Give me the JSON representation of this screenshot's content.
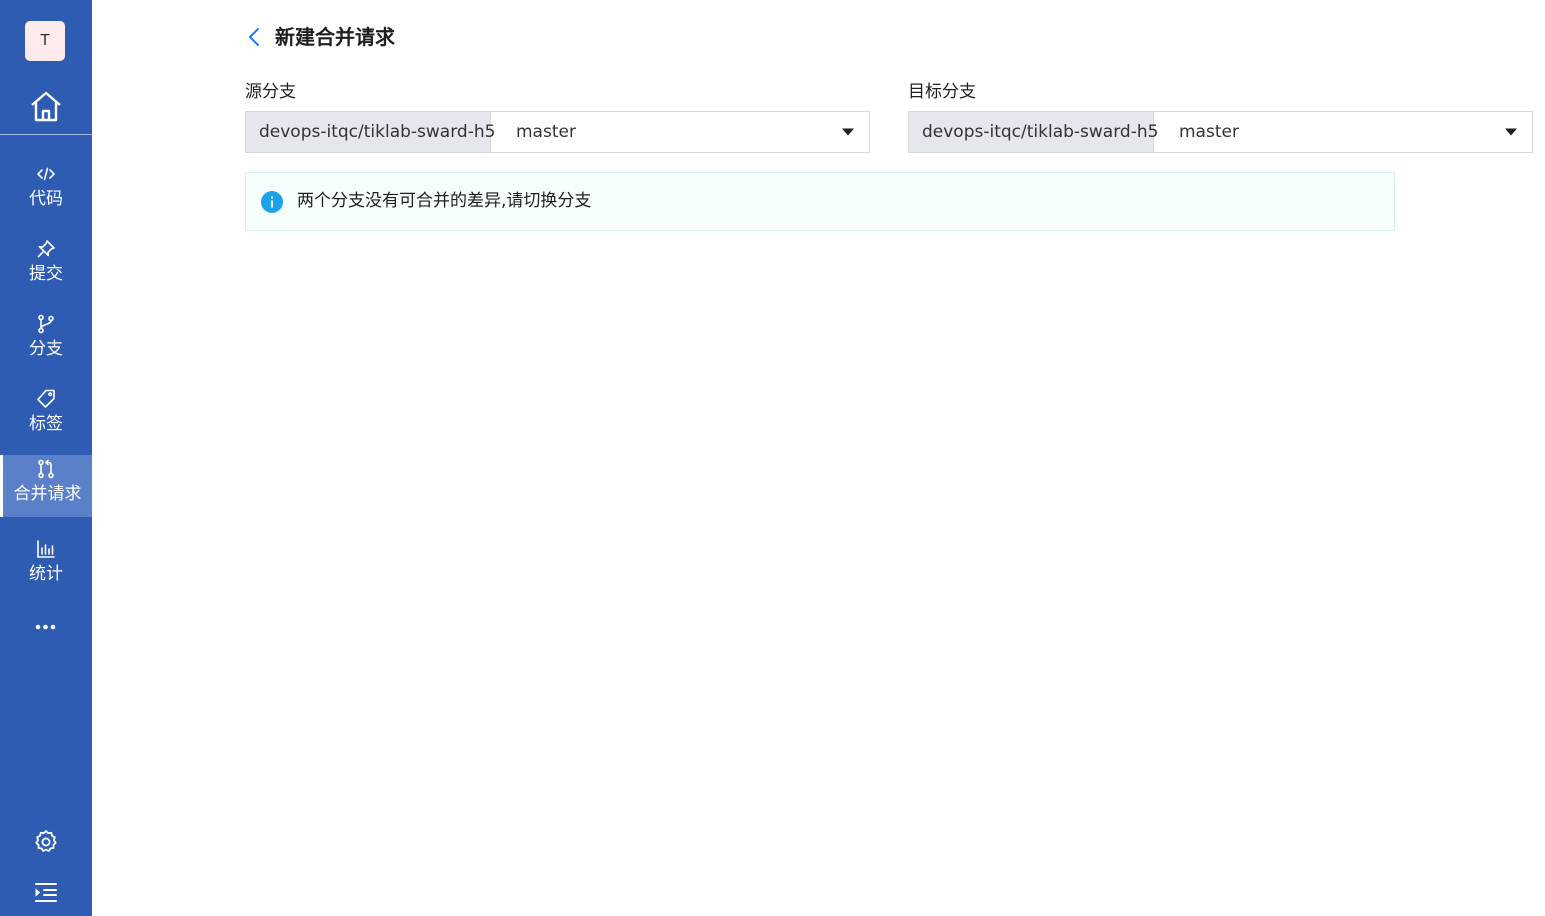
{
  "sidebar": {
    "avatar_letter": "T",
    "home_icon": "home-icon",
    "items": [
      {
        "label": "代码",
        "icon": "code-icon"
      },
      {
        "label": "提交",
        "icon": "pin-icon"
      },
      {
        "label": "分支",
        "icon": "branch-icon"
      },
      {
        "label": "标签",
        "icon": "tag-icon"
      },
      {
        "label": "合并请求",
        "icon": "merge-request-icon",
        "active": true
      },
      {
        "label": "统计",
        "icon": "bar-chart-icon"
      }
    ],
    "more_icon": "more-icon",
    "settings_icon": "gear-icon",
    "collapse_icon": "collapse-menu-icon"
  },
  "header": {
    "title": "新建合并请求",
    "back_icon": "chevron-left-icon"
  },
  "source": {
    "label": "源分支",
    "repo": "devops-itqc/tiklab-sward-h5",
    "branch": "master"
  },
  "target": {
    "label": "目标分支",
    "repo": "devops-itqc/tiklab-sward-h5",
    "branch": "master"
  },
  "alert": {
    "icon": "info-icon",
    "message": "两个分支没有可合并的差异,请切换分支"
  },
  "colors": {
    "sidebar_bg": "#2f5cb3",
    "sidebar_active": "#5a80c9",
    "accent": "#1677ff",
    "info": "#1aa3e8"
  }
}
